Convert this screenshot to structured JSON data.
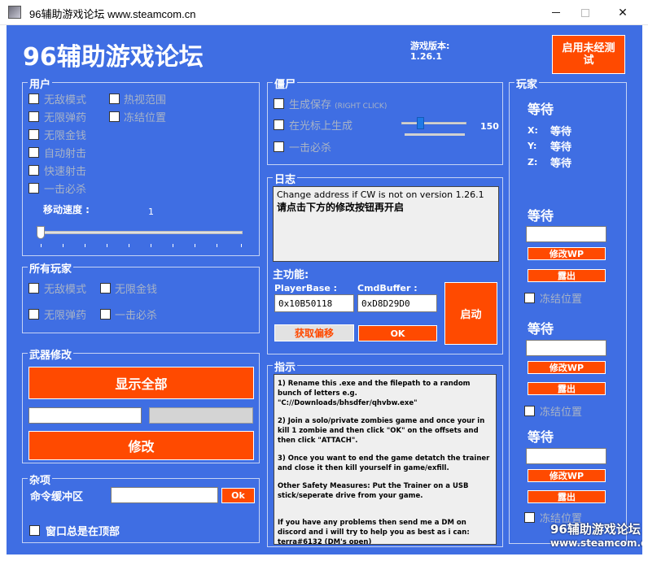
{
  "window": {
    "title": "96辅助游戏论坛 www.steamcom.cn"
  },
  "header": {
    "title": "96辅助游戏论坛",
    "version_label": "游戏版本:",
    "version_value": "1.26.1",
    "test_button": "启用未经测试"
  },
  "user_group": {
    "title": "用户",
    "left_items": [
      "无敌模式",
      "无限弹药",
      "无限金钱",
      "自动射击",
      "快速射击",
      "一击必杀"
    ],
    "right_items": [
      "热视范围",
      "冻结位置"
    ],
    "speed_label": "移动速度 :",
    "speed_value": "1"
  },
  "all_players_group": {
    "title": "所有玩家",
    "items": [
      "无敌模式",
      "无限金钱",
      "无限弹药",
      "一击必杀"
    ]
  },
  "weapon_group": {
    "title": "武器修改",
    "show_all_button": "显示全部",
    "modify_button": "修改"
  },
  "misc_group": {
    "title": "杂项",
    "cmd_label": "命令缓冲区",
    "ok_button": "Ok",
    "always_on_top": "窗口总是在顶部"
  },
  "zombie_group": {
    "title": "僵尸",
    "spawn_save": "生成保存",
    "spawn_save_hint": "(RIGHT CLICK)",
    "spawn_at_cursor": "在光标上生成",
    "slider_value": "150",
    "one_hit_kill": "一击必杀"
  },
  "log_group": {
    "title": "日志",
    "line1": "Change address if CW is not on version 1.26.1",
    "line2": "请点击下方的修改按钮再开启"
  },
  "main_func": {
    "title": "主功能:",
    "playerbase_label": "PlayerBase :",
    "cmdbuffer_label": "CmdBuffer :",
    "playerbase_value": "0x10B50118",
    "cmdbuffer_value": "0xD8D29D0",
    "start_button": "启动",
    "get_offset_button": "获取偏移",
    "ok_button": "OK"
  },
  "instructions_group": {
    "title": "指示",
    "p1": "1) Rename this .exe and the filepath to a random bunch of letters e.g. \"C://Downloads/bhsdfer/qhvbw.exe\"",
    "p2": "2) Join a solo/private zombies game and once your in kill 1 zombie and then click \"OK\" on the offsets and then click \"ATTACH\".",
    "p3": "3) Once you want to end the game detatch the trainer and close it then kill yourself in game/exfill.",
    "p4": "Other Safety Measures: Put the Trainer on a USB stick/seperate drive from your game.",
    "p5": "If you have any problems then send me a DM on discord and i will try to help you as best as i can: terra#6132 (DM's open)"
  },
  "players_group": {
    "title": "玩家",
    "wait1": "等待",
    "x_label": "X:",
    "y_label": "Y:",
    "z_label": "Z:",
    "x_value": "等待",
    "y_value": "等待",
    "z_value": "等待",
    "players": [
      {
        "name": "等待",
        "modify": "修改WP",
        "expose": "露出",
        "freeze": "冻结位置"
      },
      {
        "name": "等待",
        "modify": "修改WP",
        "expose": "露出",
        "freeze": "冻结位置"
      },
      {
        "name": "等待",
        "modify": "修改WP",
        "expose": "露出",
        "freeze": "冻结位置"
      }
    ]
  },
  "watermark": {
    "line1": "96辅助游戏论坛",
    "line2": "www.steamcom.cn"
  }
}
